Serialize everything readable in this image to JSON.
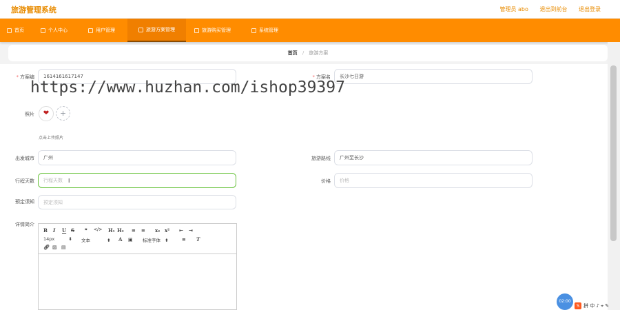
{
  "header": {
    "title": "旅游管理系统",
    "user_label": "管理员 abo",
    "back_link": "退出到前台",
    "logout_link": "退出登录"
  },
  "nav": {
    "items": [
      {
        "label": "首页",
        "icon": "home-icon"
      },
      {
        "label": "个人中心",
        "icon": "person-icon"
      },
      {
        "label": "用户管理",
        "icon": "user-icon"
      },
      {
        "label": "旅游方案管理",
        "icon": "plan-icon"
      },
      {
        "label": "旅游购买管理",
        "icon": "cart-icon"
      },
      {
        "label": "系统管理",
        "icon": "settings-icon"
      }
    ],
    "active_index": 3,
    "active_bg": "#f07f00"
  },
  "breadcrumb": {
    "home": "首页",
    "separator": "/",
    "current": "旅游方案"
  },
  "form": {
    "plan_no_label": "方案编",
    "plan_no_value": "1614161617147",
    "plan_name_label": "方案名",
    "plan_name_value": "长沙七日游",
    "photo_label": "照片",
    "photo_add": "+",
    "photo_hint": "点击上传照片",
    "city_label": "出发城市",
    "city_value": "广州",
    "route_label": "旅游路线",
    "route_value": "广州至长沙",
    "days_label": "行程天数",
    "days_placeholder": "行程天数",
    "price_label": "价格",
    "price_placeholder": "价格",
    "booking_label": "预定须知",
    "booking_placeholder": "预定须知",
    "detail_label": "详情简介"
  },
  "editor": {
    "row1": [
      "B",
      "I",
      "U",
      "S",
      "❞",
      "</>",
      "H₁",
      "H₂",
      "≡",
      "≡",
      "x₂",
      "x²",
      "⇤",
      "⇥"
    ],
    "font_size": "14px",
    "text_style": "文本",
    "font_family": "标准字体"
  },
  "watermark": "https://www.huzhan.com/ishop39397",
  "float_button": "02:00",
  "tray": {
    "badge": "S",
    "text": "拼 中 ♪ ⌖ ✎"
  },
  "colors": {
    "brand_orange": "#ff8c00",
    "title_orange": "#e88b00",
    "required_red": "#f56c6c",
    "focus_green": "#67c23a"
  }
}
